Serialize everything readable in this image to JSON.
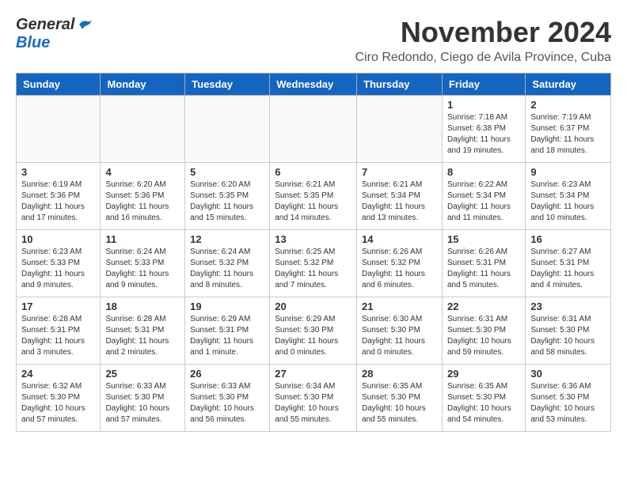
{
  "header": {
    "logo_general": "General",
    "logo_blue": "Blue",
    "month_title": "November 2024",
    "location": "Ciro Redondo, Ciego de Avila Province, Cuba"
  },
  "calendar": {
    "days_of_week": [
      "Sunday",
      "Monday",
      "Tuesday",
      "Wednesday",
      "Thursday",
      "Friday",
      "Saturday"
    ],
    "weeks": [
      [
        {
          "day": "",
          "info": ""
        },
        {
          "day": "",
          "info": ""
        },
        {
          "day": "",
          "info": ""
        },
        {
          "day": "",
          "info": ""
        },
        {
          "day": "",
          "info": ""
        },
        {
          "day": "1",
          "info": "Sunrise: 7:18 AM\nSunset: 6:38 PM\nDaylight: 11 hours and 19 minutes."
        },
        {
          "day": "2",
          "info": "Sunrise: 7:19 AM\nSunset: 6:37 PM\nDaylight: 11 hours and 18 minutes."
        }
      ],
      [
        {
          "day": "3",
          "info": "Sunrise: 6:19 AM\nSunset: 5:36 PM\nDaylight: 11 hours and 17 minutes."
        },
        {
          "day": "4",
          "info": "Sunrise: 6:20 AM\nSunset: 5:36 PM\nDaylight: 11 hours and 16 minutes."
        },
        {
          "day": "5",
          "info": "Sunrise: 6:20 AM\nSunset: 5:35 PM\nDaylight: 11 hours and 15 minutes."
        },
        {
          "day": "6",
          "info": "Sunrise: 6:21 AM\nSunset: 5:35 PM\nDaylight: 11 hours and 14 minutes."
        },
        {
          "day": "7",
          "info": "Sunrise: 6:21 AM\nSunset: 5:34 PM\nDaylight: 11 hours and 13 minutes."
        },
        {
          "day": "8",
          "info": "Sunrise: 6:22 AM\nSunset: 5:34 PM\nDaylight: 11 hours and 11 minutes."
        },
        {
          "day": "9",
          "info": "Sunrise: 6:23 AM\nSunset: 5:34 PM\nDaylight: 11 hours and 10 minutes."
        }
      ],
      [
        {
          "day": "10",
          "info": "Sunrise: 6:23 AM\nSunset: 5:33 PM\nDaylight: 11 hours and 9 minutes."
        },
        {
          "day": "11",
          "info": "Sunrise: 6:24 AM\nSunset: 5:33 PM\nDaylight: 11 hours and 9 minutes."
        },
        {
          "day": "12",
          "info": "Sunrise: 6:24 AM\nSunset: 5:32 PM\nDaylight: 11 hours and 8 minutes."
        },
        {
          "day": "13",
          "info": "Sunrise: 6:25 AM\nSunset: 5:32 PM\nDaylight: 11 hours and 7 minutes."
        },
        {
          "day": "14",
          "info": "Sunrise: 6:26 AM\nSunset: 5:32 PM\nDaylight: 11 hours and 6 minutes."
        },
        {
          "day": "15",
          "info": "Sunrise: 6:26 AM\nSunset: 5:31 PM\nDaylight: 11 hours and 5 minutes."
        },
        {
          "day": "16",
          "info": "Sunrise: 6:27 AM\nSunset: 5:31 PM\nDaylight: 11 hours and 4 minutes."
        }
      ],
      [
        {
          "day": "17",
          "info": "Sunrise: 6:28 AM\nSunset: 5:31 PM\nDaylight: 11 hours and 3 minutes."
        },
        {
          "day": "18",
          "info": "Sunrise: 6:28 AM\nSunset: 5:31 PM\nDaylight: 11 hours and 2 minutes."
        },
        {
          "day": "19",
          "info": "Sunrise: 6:29 AM\nSunset: 5:31 PM\nDaylight: 11 hours and 1 minute."
        },
        {
          "day": "20",
          "info": "Sunrise: 6:29 AM\nSunset: 5:30 PM\nDaylight: 11 hours and 0 minutes."
        },
        {
          "day": "21",
          "info": "Sunrise: 6:30 AM\nSunset: 5:30 PM\nDaylight: 11 hours and 0 minutes."
        },
        {
          "day": "22",
          "info": "Sunrise: 6:31 AM\nSunset: 5:30 PM\nDaylight: 10 hours and 59 minutes."
        },
        {
          "day": "23",
          "info": "Sunrise: 6:31 AM\nSunset: 5:30 PM\nDaylight: 10 hours and 58 minutes."
        }
      ],
      [
        {
          "day": "24",
          "info": "Sunrise: 6:32 AM\nSunset: 5:30 PM\nDaylight: 10 hours and 57 minutes."
        },
        {
          "day": "25",
          "info": "Sunrise: 6:33 AM\nSunset: 5:30 PM\nDaylight: 10 hours and 57 minutes."
        },
        {
          "day": "26",
          "info": "Sunrise: 6:33 AM\nSunset: 5:30 PM\nDaylight: 10 hours and 56 minutes."
        },
        {
          "day": "27",
          "info": "Sunrise: 6:34 AM\nSunset: 5:30 PM\nDaylight: 10 hours and 55 minutes."
        },
        {
          "day": "28",
          "info": "Sunrise: 6:35 AM\nSunset: 5:30 PM\nDaylight: 10 hours and 55 minutes."
        },
        {
          "day": "29",
          "info": "Sunrise: 6:35 AM\nSunset: 5:30 PM\nDaylight: 10 hours and 54 minutes."
        },
        {
          "day": "30",
          "info": "Sunrise: 6:36 AM\nSunset: 5:30 PM\nDaylight: 10 hours and 53 minutes."
        }
      ]
    ]
  }
}
